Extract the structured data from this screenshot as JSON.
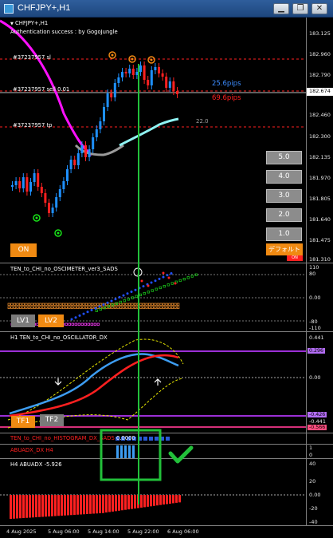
{
  "window": {
    "title": "CHFJPY+,H1",
    "minimize": "▁",
    "restore": "❐",
    "close": "✕"
  },
  "main": {
    "symbol_label": "CHFJPY+,H1",
    "auth_text": "Authentication success : by GogoJungle",
    "sl_label": "#37237957 sl",
    "sell_label": "#37237957 sell 0.01",
    "tp_label": "#37237957 tp",
    "pips_upper": "25.6pips",
    "pips_lower": "69.6pips",
    "level_value": "22.0",
    "current_price": "182.674",
    "price_axis": [
      "183.125",
      "182.960",
      "182.790",
      "182.460",
      "182.300",
      "182.135",
      "181.970",
      "181.805",
      "181.640",
      "181.475",
      "181.310"
    ],
    "lot_buttons": [
      "5.0",
      "4.0",
      "3.0",
      "2.0",
      "1.0"
    ],
    "on_button": "ON",
    "default_button": "デフォルト",
    "default_marker": "ON"
  },
  "osc1": {
    "title": "TEN_to_CHI_no_OSCIMETER_ver3_SADS",
    "axis": [
      "110",
      "80",
      "0.00",
      "-80",
      "-110"
    ],
    "lv1": "LV1",
    "lv2": "LV2"
  },
  "osc2": {
    "title": "H1 TEN_to_CHI_no_OSCILLATOR_DX",
    "axis": [
      "0.441",
      "0.00",
      "-0.441"
    ],
    "tag_upper": "0.296",
    "tag_lower1": "-0.426",
    "tag_lower2": "-0.566",
    "tf1": "TF1",
    "tf2": "TF2"
  },
  "hist": {
    "title": "TEN_to_CHI_no_HISTOGRAM_DX_SADS",
    "value": "0.0000",
    "axis": [
      "1",
      "-1"
    ]
  },
  "abuadx_h4": {
    "title": "ABUADX_DX H4",
    "axis": [
      "1",
      "0"
    ]
  },
  "abuadx": {
    "title": "H4 ABUADX",
    "value": "-5.926",
    "axis": [
      "40",
      "20",
      "0.00",
      "-20",
      "-40"
    ]
  },
  "date_axis": [
    "4 Aug 2025",
    "5 Aug 06:00",
    "5 Aug 14:00",
    "5 Aug 22:00",
    "6 Aug 06:00"
  ],
  "colors": {
    "bull": "#1e90ff",
    "bear": "#ff2020",
    "accent": "#f08a12",
    "annotation": "#22c03a"
  }
}
